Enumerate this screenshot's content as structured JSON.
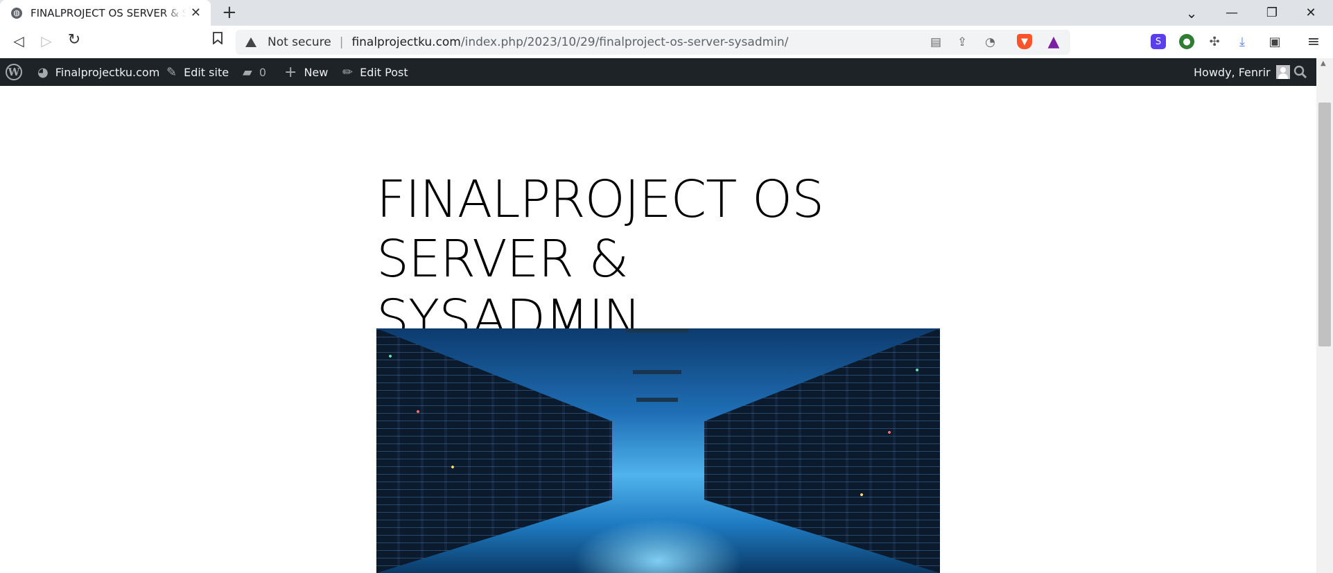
{
  "browser": {
    "tab": {
      "title": "FINALPROJECT OS SERVER & SYSADMIN",
      "icon": "globe-icon"
    },
    "new_tab_symbol": "+",
    "window_controls": {
      "tab_search": "⌄",
      "minimize": "—",
      "restore": "❐",
      "close": "✕"
    },
    "nav": {
      "back": "◁",
      "forward": "▷",
      "reload": "↻",
      "bookmark": "☐"
    },
    "address": {
      "security_label": "Not secure",
      "host": "finalprojectku.com",
      "path": "/index.php/2023/10/29/finalproject-os-server-sysadmin/"
    },
    "omnibox_icons": [
      "reader-mode-icon",
      "share-icon",
      "rss-icon",
      "brave-shields-icon",
      "brave-rewards-icon"
    ],
    "extensions": [
      "sync-extension-icon",
      "globe-extension-icon",
      "puzzle-icon",
      "download-icon",
      "wallet-icon",
      "menu-icon"
    ]
  },
  "admin_bar": {
    "site_name": "Finalprojectku.com",
    "edit_site": "Edit site",
    "comments_count": "0",
    "new": "New",
    "edit_post": "Edit Post",
    "howdy": "Howdy, Fenrir"
  },
  "post": {
    "title": "FINALPROJECT OS SERVER & SYSADMIN",
    "featured_image": "server-room-image"
  },
  "colors": {
    "admin_bar_bg": "#1d2327",
    "tab_strip_bg": "#dfe3e8",
    "omnibox_bg": "#f1f3f4"
  }
}
